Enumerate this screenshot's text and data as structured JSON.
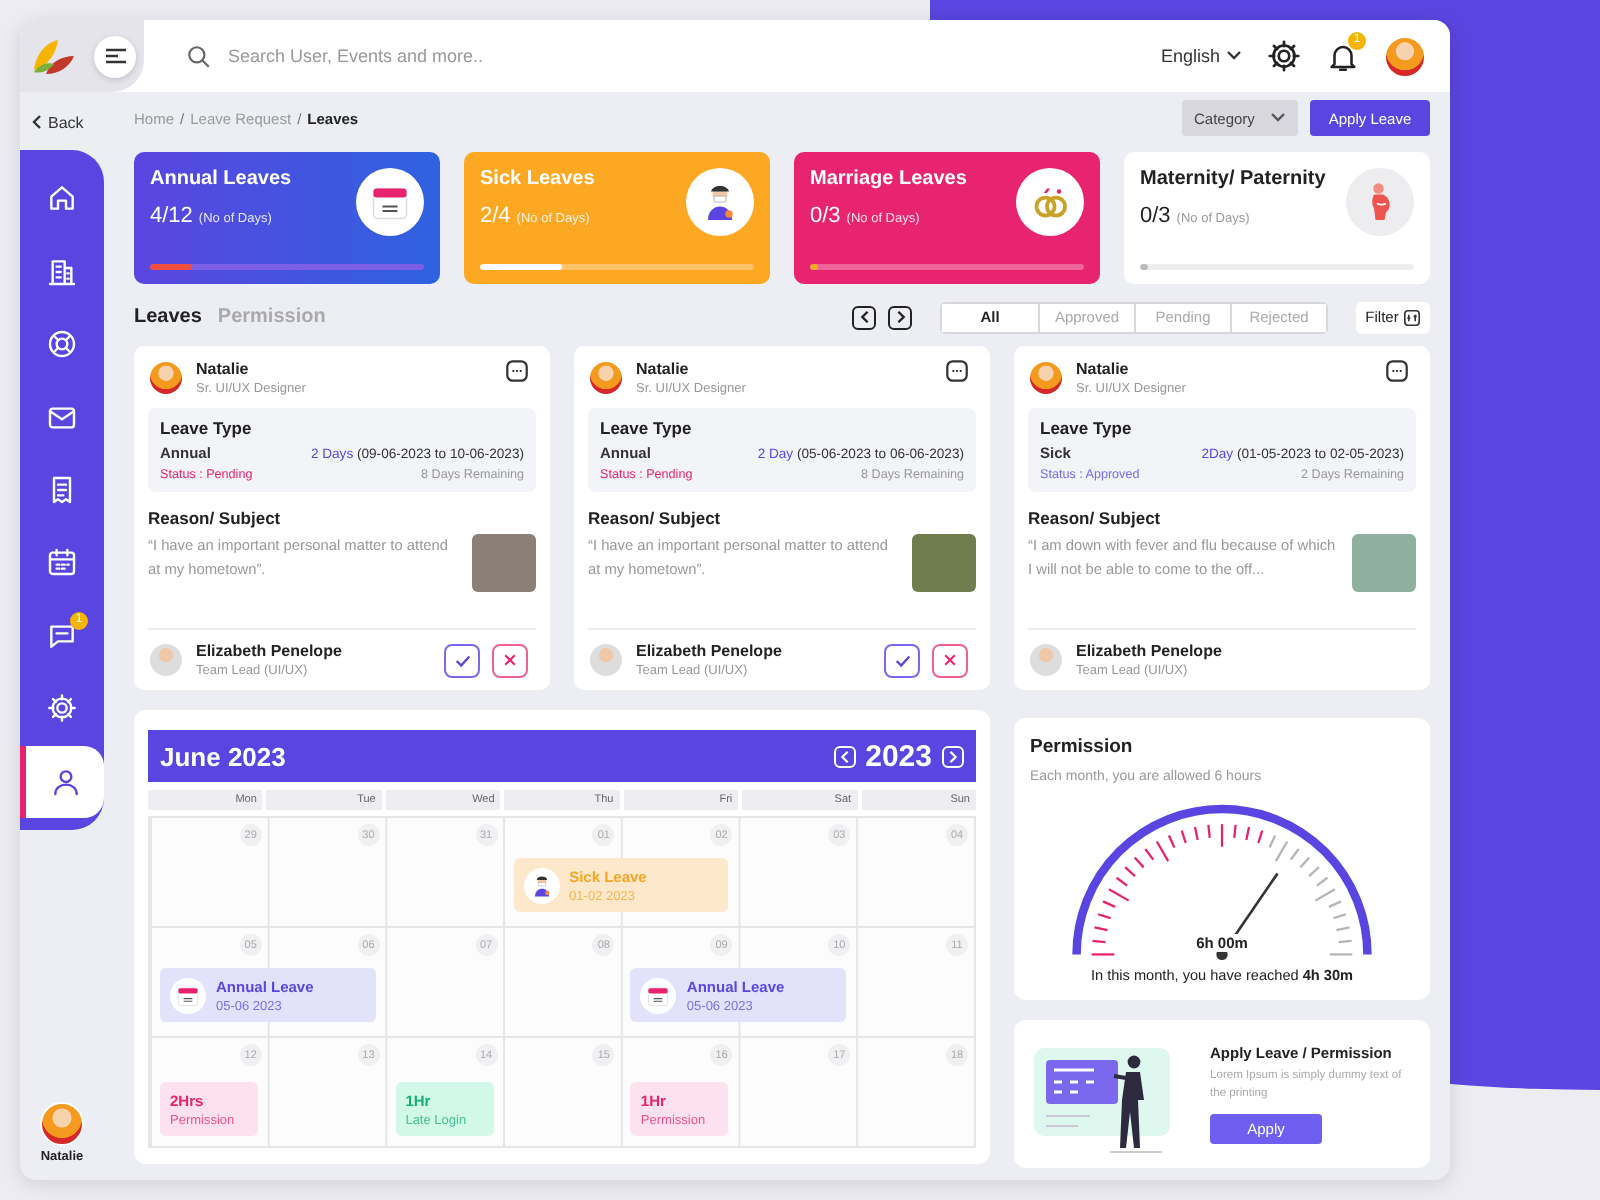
{
  "topbar": {
    "search": {
      "placeholder": "Search User, Events and more.."
    },
    "language": "English",
    "notification_badge": "1"
  },
  "back": "Back",
  "sidebar": {
    "items": [
      {
        "kind": "home",
        "selected": false
      },
      {
        "kind": "building",
        "selected": false
      },
      {
        "kind": "lifebuoy",
        "selected": false
      },
      {
        "kind": "mail",
        "selected": false
      },
      {
        "kind": "document",
        "selected": false
      },
      {
        "kind": "calendar",
        "selected": false
      },
      {
        "kind": "chat",
        "selected": false,
        "badge": "1"
      },
      {
        "kind": "settings",
        "selected": false
      },
      {
        "kind": "person",
        "selected": true
      }
    ]
  },
  "user": {
    "name": "Natalie"
  },
  "breadcrumb": {
    "separator": "/",
    "items": [
      {
        "label": "Home",
        "current": false
      },
      {
        "label": "Leave Request",
        "current": false
      },
      {
        "label": "Leaves",
        "current": true
      }
    ]
  },
  "category": "Category",
  "apply_button": "Apply Leave",
  "stats": [
    {
      "kind": "annual",
      "title": "Annual Leaves",
      "value": "4/12",
      "unit": "(No of Days)",
      "level": 0.15
    },
    {
      "kind": "sick",
      "title": "Sick Leaves",
      "value": "2/4",
      "unit": "(No of Days)",
      "level": 0.3
    },
    {
      "kind": "marriage",
      "title": "Marriage Leaves",
      "value": "0/3",
      "unit": "(No of Days)",
      "level": 0.03
    },
    {
      "kind": "maternity",
      "title": "Maternity/ Paternity",
      "value": "0/3",
      "unit": "(No of Days)",
      "level": 0.03
    }
  ],
  "tabs": [
    {
      "label": "Leaves",
      "selected": true
    },
    {
      "label": "Permission",
      "selected": false
    }
  ],
  "filters": [
    {
      "label": "All",
      "selected": true
    },
    {
      "label": "Approved",
      "selected": false
    },
    {
      "label": "Pending",
      "selected": false
    },
    {
      "label": "Rejected",
      "selected": false
    }
  ],
  "filter_button": "Filter",
  "requests": [
    {
      "name": "Natalie",
      "role": "Sr. UI/UX Designer",
      "type_label": "Leave Type",
      "type": "Annual",
      "days": "2 Days",
      "range": "(09-06-2023 to 10-06-2023)",
      "status": {
        "kind": "pending",
        "label": "Status : Pending"
      },
      "remaining": "8 Days Remaining",
      "reason_label": "Reason/ Subject",
      "reason": "“I have an important personal matter to attend at my hometown”.",
      "approver": "Elizabeth Penelope",
      "approver_role": "Team Lead (UI/UX)",
      "actions": true
    },
    {
      "name": "Natalie",
      "role": "Sr. UI/UX Designer",
      "type_label": "Leave Type",
      "type": "Annual",
      "days": "2 Day",
      "range": "(05-06-2023 to 06-06-2023)",
      "status": {
        "kind": "pending",
        "label": "Status : Pending"
      },
      "remaining": "8 Days Remaining",
      "reason_label": "Reason/ Subject",
      "reason": "“I have an important personal matter to attend at my hometown”.",
      "approver": "Elizabeth Penelope",
      "approver_role": "Team Lead (UI/UX)",
      "actions": true
    },
    {
      "name": "Natalie",
      "role": "Sr. UI/UX Designer",
      "type_label": "Leave Type",
      "type": "Sick",
      "days": "2Day",
      "range": "(01-05-2023 to 02-05-2023)",
      "status": {
        "kind": "approved",
        "label": "Status : Approved"
      },
      "remaining": "2 Days Remaining",
      "reason_label": "Reason/ Subject",
      "reason": "“I am down with fever and flu because of which I will not be able to come to the off...",
      "approver": "Elizabeth Penelope",
      "approver_role": "Team Lead (UI/UX)",
      "actions": false
    }
  ],
  "calendar": {
    "month": "June 2023",
    "year": "2023",
    "weekdays": [
      "Mon",
      "Tue",
      "Wed",
      "Thu",
      "Fri",
      "Sat",
      "Sun"
    ],
    "weeks": [
      {
        "days": [
          {
            "date": "29"
          },
          {
            "date": "30"
          },
          {
            "date": "31"
          },
          {
            "date": "01",
            "events": [
              {
                "kind": "sick",
                "title": "Sick Leave",
                "date": "01-02 2023",
                "multi_day": true
              }
            ]
          },
          {
            "date": "02"
          },
          {
            "date": "03"
          },
          {
            "date": "04"
          }
        ]
      },
      {
        "days": [
          {
            "date": "05",
            "events": [
              {
                "kind": "annual",
                "title": "Annual Leave",
                "date": "05-06 2023",
                "multi_day": true
              }
            ]
          },
          {
            "date": "06"
          },
          {
            "date": "07"
          },
          {
            "date": "08"
          },
          {
            "date": "09",
            "events": [
              {
                "kind": "annual",
                "title": "Annual Leave",
                "date": "05-06 2023",
                "multi_day": true
              }
            ]
          },
          {
            "date": "10"
          },
          {
            "date": "11"
          }
        ]
      },
      {
        "days": [
          {
            "date": "12",
            "events": [
              {
                "kind": "permission",
                "title": "2Hrs",
                "date": "Permission",
                "multi_day": false
              }
            ]
          },
          {
            "date": "13"
          },
          {
            "date": "14",
            "events": [
              {
                "kind": "late",
                "title": "1Hr",
                "date": "Late Login",
                "multi_day": false
              }
            ]
          },
          {
            "date": "15"
          },
          {
            "date": "16",
            "events": [
              {
                "kind": "permission",
                "title": "1Hr",
                "date": "Permission",
                "multi_day": false
              }
            ]
          },
          {
            "date": "17"
          },
          {
            "date": "18"
          }
        ]
      }
    ]
  },
  "permission": {
    "title": "Permission",
    "subtitle": "Each month, you are allowed 6 hours",
    "gauge_label": "6h 00m",
    "summary": "In this month, you have reached **4h 30m**"
  },
  "promo": {
    "title": "Apply Leave / Permission",
    "text": "Lorem Ipsum is simply dummy text of the printing",
    "button": "Apply"
  }
}
